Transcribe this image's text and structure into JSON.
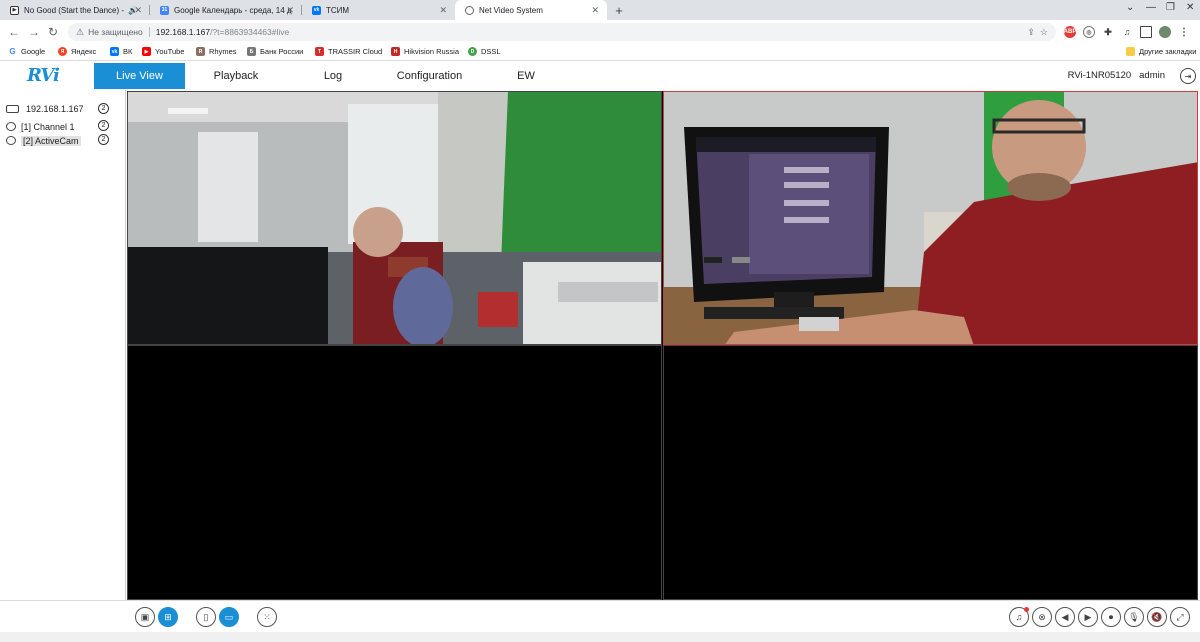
{
  "browser": {
    "tabs": [
      {
        "title": "No Good (Start the Dance) -",
        "favicon": "youtube-play-icon",
        "color": "#222222",
        "extra": "🔊"
      },
      {
        "title": "Google Календарь - среда, 14 д",
        "favicon": "calendar-icon",
        "color": "#4285f4"
      },
      {
        "title": "ТСИМ",
        "favicon": "vk-icon",
        "color": "#0077ff"
      },
      {
        "title": "Net Video System",
        "favicon": "globe-icon",
        "color": "#5f6368"
      }
    ],
    "address": {
      "security": "Не защищено",
      "url_host": "192.168.1.167",
      "url_rest": "/?t=8863934463#live"
    },
    "bookmarks": [
      {
        "label": "Google",
        "color": "#4285f4",
        "glyph": "G"
      },
      {
        "label": "Яндекс",
        "color": "#fc3f1d",
        "glyph": "Я"
      },
      {
        "label": "ВК",
        "color": "#0077ff",
        "glyph": "vk"
      },
      {
        "label": "YouTube",
        "color": "#ff0000",
        "glyph": "▶"
      },
      {
        "label": "Rhymes",
        "color": "#8d6e63",
        "glyph": "R"
      },
      {
        "label": "Банк России",
        "color": "#777777",
        "glyph": "Б"
      },
      {
        "label": "TRASSIR Cloud",
        "color": "#d32f2f",
        "glyph": "T"
      },
      {
        "label": "Hikvision Russia",
        "color": "#c62828",
        "glyph": "H"
      },
      {
        "label": "DSSL",
        "color": "#43a047",
        "glyph": "D"
      }
    ],
    "other_bookmarks": "Другие закладки"
  },
  "app": {
    "logo": "RVi",
    "menu": [
      "Live View",
      "Playback",
      "Log",
      "Configuration",
      "EW"
    ],
    "active_menu": "Live View",
    "device_name": "RVi-1NR05120",
    "user": "admin"
  },
  "tree": {
    "device": {
      "label": "192.168.1.167",
      "count": "2"
    },
    "channels": [
      {
        "label": "[1] Channel 1",
        "count": "2"
      },
      {
        "label": "[2] ActiveCam",
        "count": "2",
        "selected": true
      }
    ]
  },
  "layout": {
    "grid": "2x2",
    "selected_cell": 2
  },
  "colors": {
    "accent": "#1a8fd6",
    "selected_border": "#d43c3c"
  }
}
